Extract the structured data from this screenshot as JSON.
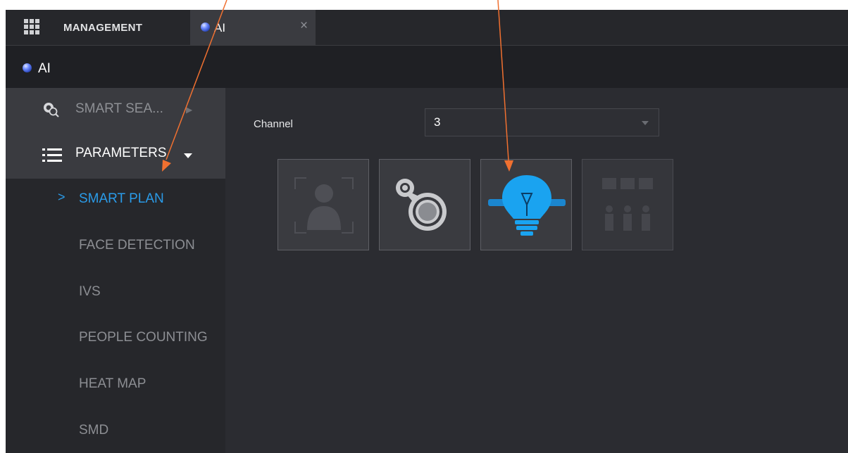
{
  "tabbar": {
    "management_label": "MANAGEMENT",
    "management_icon": "grid-icon",
    "active_tab_label": "AI",
    "active_tab_icon": "ai-orb-icon",
    "close_symbol": "×"
  },
  "titlebar": {
    "title": "AI",
    "icon": "ai-orb-icon"
  },
  "sidebar": {
    "smart_search": {
      "label": "SMART SEA...",
      "icon": "smart-search-icon"
    },
    "parameters": {
      "label": "PARAMETERS",
      "icon": "list-icon"
    },
    "sub_items": [
      {
        "label": "SMART PLAN",
        "active": true
      },
      {
        "label": "FACE DETECTION"
      },
      {
        "label": "IVS"
      },
      {
        "label": "PEOPLE COUNTING"
      },
      {
        "label": "HEAT MAP"
      },
      {
        "label": "SMD"
      }
    ],
    "active_marker": ">"
  },
  "main": {
    "channel_label": "Channel",
    "channel_value": "3",
    "plan_buttons": [
      {
        "icon": "face-detection-icon",
        "state": "inactive"
      },
      {
        "icon": "heat-map-icon",
        "state": "inactive"
      },
      {
        "icon": "ivs-bulb-icon",
        "state": "selected"
      },
      {
        "icon": "people-counting-icon",
        "state": "disabled"
      }
    ]
  },
  "colors": {
    "accent": "#2a9be8",
    "bulb": "#1aa3f0",
    "annotation_arrow": "#f07030",
    "panel_bg": "#2b2c31",
    "sidebar_bg": "#26272b"
  }
}
